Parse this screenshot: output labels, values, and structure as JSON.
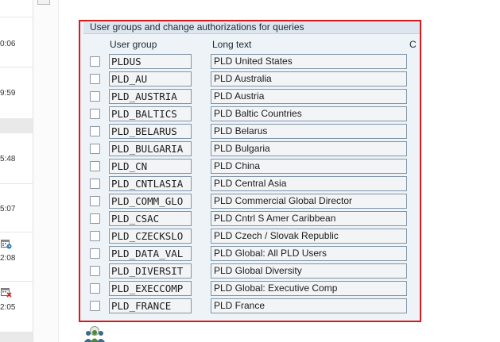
{
  "sidebar": {
    "timestamps": [
      "0:06",
      "9:59",
      "5:48",
      "5:07",
      "2:08",
      "2:05"
    ]
  },
  "panel": {
    "title": "User groups and change authorizations for queries",
    "col_user_group": "User group",
    "col_long_text": "Long text",
    "col_cut": "C",
    "rows": [
      {
        "code": "PLDUS",
        "text": "PLD United States"
      },
      {
        "code": "PLD_AU",
        "text": "PLD Australia"
      },
      {
        "code": "PLD_AUSTRIA",
        "text": "PLD Austria"
      },
      {
        "code": "PLD_BALTICS",
        "text": "PLD Baltic Countries"
      },
      {
        "code": "PLD_BELARUS",
        "text": "PLD Belarus"
      },
      {
        "code": "PLD_BULGARIA",
        "text": "PLD Bulgaria"
      },
      {
        "code": "PLD_CN",
        "text": "PLD China"
      },
      {
        "code": "PLD_CNTLASIA",
        "text": "PLD Central Asia"
      },
      {
        "code": "PLD_COMM_GLO",
        "text": "PLD Commercial Global Director"
      },
      {
        "code": "PLD_CSAC",
        "text": "PLD Cntrl S Amer Caribbean"
      },
      {
        "code": "PLD_CZECKSLO",
        "text": "PLD Czech / Slovak Republic"
      },
      {
        "code": "PLD_DATA_VAL",
        "text": "PLD Global: All PLD Users"
      },
      {
        "code": "PLD_DIVERSIT",
        "text": "PLD Global Diversity"
      },
      {
        "code": "PLD_EXECCOMP",
        "text": "PLD Global: Executive Comp"
      },
      {
        "code": "PLD_FRANCE",
        "text": "PLD France"
      }
    ]
  },
  "colors": {
    "highlight_border": "#d71a1a",
    "panel_bg": "#eef3f8",
    "field_border": "#7f95a8"
  }
}
